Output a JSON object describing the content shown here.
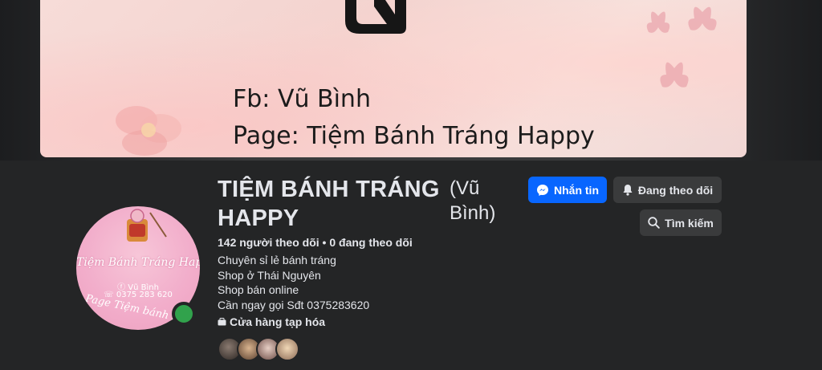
{
  "cover": {
    "line1": "Fb: Vũ Bình",
    "line2": "Page: Tiệm Bánh Tráng Happy"
  },
  "avatar": {
    "script_text": "Tiệm Bánh Tráng Happy",
    "fb_name": "ⓕ Vũ Bình",
    "phone": "☏ 0375 283 620",
    "arc_text": "Page Tiệm bánh tráng"
  },
  "profile": {
    "name": "TIỆM BÁNH TRÁNG HAPPY",
    "alt_name": "(Vũ Bình)",
    "stats": "142 người theo dõi • 0 đang theo dõi",
    "bio": [
      "Chuyên sỉ lẻ bánh tráng",
      "Shop ở Thái Nguyên",
      "Shop bán online",
      "Cần ngay gọi Sđt 0375283620"
    ],
    "category": "Cửa hàng tạp hóa"
  },
  "actions": {
    "message_label": "Nhắn tin",
    "following_label": "Đang theo dõi",
    "search_label": "Tìm kiếm"
  },
  "icons": {
    "message": "messenger-icon",
    "following": "bell-icon",
    "search": "search-icon",
    "category": "shop-icon"
  },
  "colors": {
    "background": "#242526",
    "primary_button": "#0866ff",
    "secondary_button": "#3a3b3c",
    "online": "#31a24c",
    "avatar_pink": "#f2aecb"
  }
}
